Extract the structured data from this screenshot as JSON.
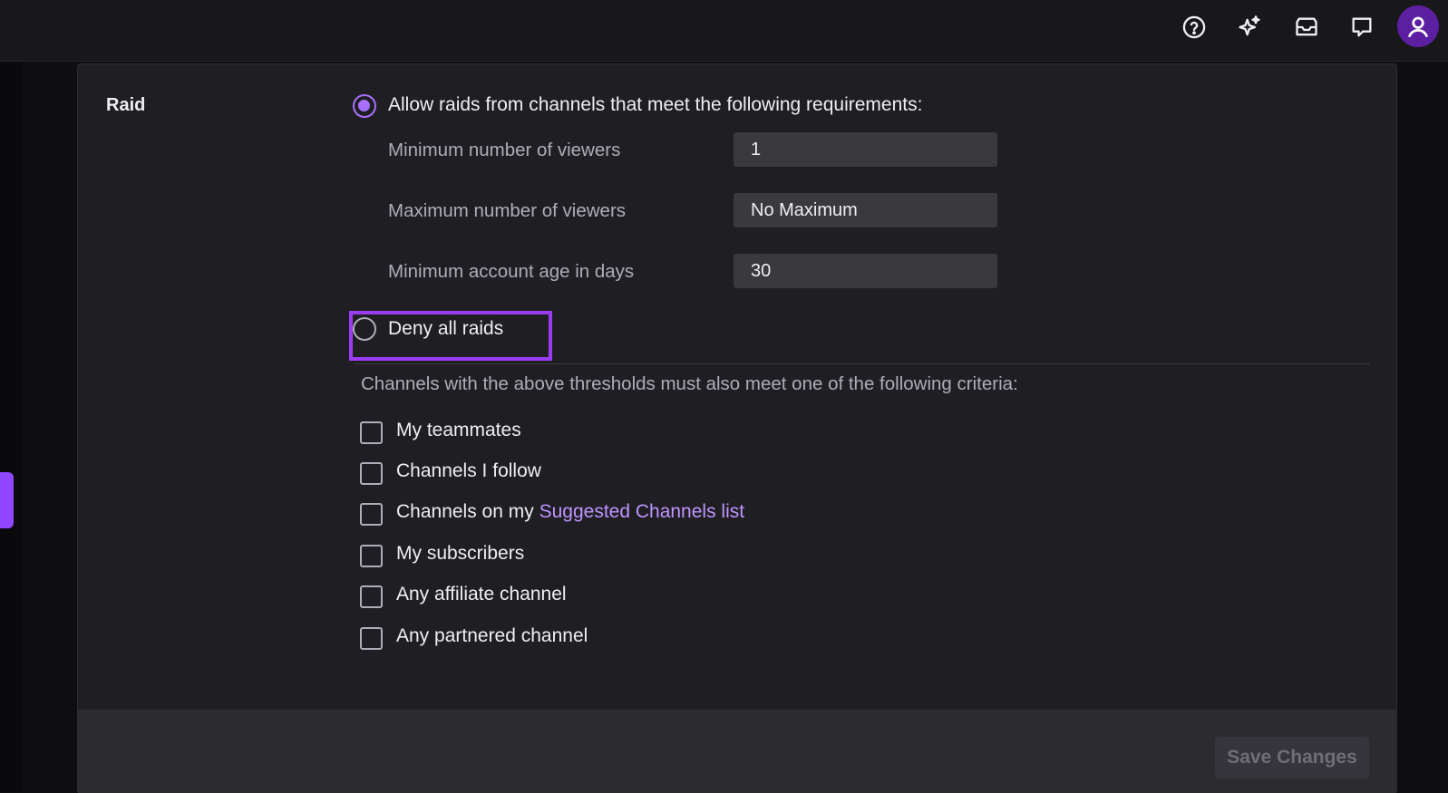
{
  "topbar": {
    "icons": [
      "help-icon",
      "sparkle-icon",
      "inbox-icon",
      "whispers-icon",
      "user-avatar-icon"
    ]
  },
  "colors": {
    "accent": "#a970ff",
    "highlight": "#9b3cf3",
    "panel": "#1f1f23",
    "link": "#bf94ff"
  },
  "raid": {
    "section_label": "Raid",
    "allow_option": {
      "label": "Allow raids from channels that meet the following requirements:",
      "selected": true
    },
    "fields": [
      {
        "label": "Minimum number of viewers",
        "value": "1"
      },
      {
        "label": "Maximum number of viewers",
        "value": "No Maximum"
      },
      {
        "label": "Minimum account age in days",
        "value": "30"
      }
    ],
    "deny_option": {
      "label": "Deny all raids",
      "selected": false
    },
    "criteria_note": "Channels with the above thresholds must also meet one of the following criteria:",
    "criteria": [
      {
        "label": "My teammates",
        "checked": false
      },
      {
        "label": "Channels I follow",
        "checked": false
      },
      {
        "label": "Channels on my",
        "link": "Suggested Channels list",
        "checked": false
      },
      {
        "label": "My subscribers",
        "checked": false
      },
      {
        "label": "Any affiliate channel",
        "checked": false
      },
      {
        "label": "Any partnered channel",
        "checked": false
      }
    ]
  },
  "footer": {
    "save_label": "Save Changes"
  }
}
